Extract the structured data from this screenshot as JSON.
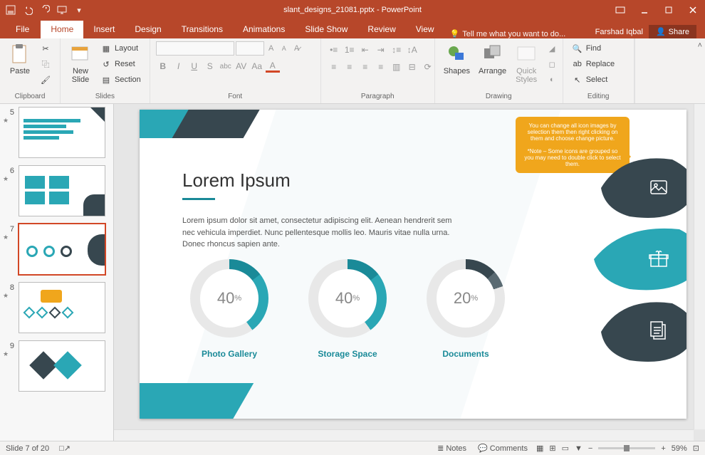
{
  "title": "slant_designs_21081.pptx - PowerPoint",
  "user": "Farshad Iqbal",
  "share": "Share",
  "tellme": "Tell me what you want to do...",
  "tabs": {
    "file": "File",
    "home": "Home",
    "insert": "Insert",
    "design": "Design",
    "transitions": "Transitions",
    "animations": "Animations",
    "slideshow": "Slide Show",
    "review": "Review",
    "view": "View"
  },
  "ribbon": {
    "clipboard": {
      "label": "Clipboard",
      "paste": "Paste"
    },
    "slides": {
      "label": "Slides",
      "new": "New\nSlide",
      "layout": "Layout",
      "reset": "Reset",
      "section": "Section"
    },
    "font": {
      "label": "Font"
    },
    "paragraph": {
      "label": "Paragraph"
    },
    "drawing": {
      "label": "Drawing",
      "shapes": "Shapes",
      "arrange": "Arrange",
      "quick": "Quick\nStyles"
    },
    "editing": {
      "label": "Editing",
      "find": "Find",
      "replace": "Replace",
      "select": "Select"
    }
  },
  "thumbs": [
    {
      "num": "5"
    },
    {
      "num": "6"
    },
    {
      "num": "7",
      "selected": true
    },
    {
      "num": "8"
    },
    {
      "num": "9"
    }
  ],
  "slide": {
    "title": "Lorem Ipsum",
    "body": "Lorem ipsum dolor sit amet, consectetur adipiscing elit. Aenean hendrerit sem nec vehicula imperdiet. Nunc pellentesque mollis leo. Mauris vitae nulla urna. Donec rhoncus sapien ante.",
    "note": "You can change all icon images by selection them then right clicking on them and choose change picture.",
    "note2": "*Note – Some icons are grouped so you may need to double click to select them.",
    "donuts": [
      {
        "value": "40",
        "pct": "%",
        "label": "Photo Gallery",
        "fill": 40
      },
      {
        "value": "40",
        "pct": "%",
        "label": "Storage Space",
        "fill": 40
      },
      {
        "value": "20",
        "pct": "%",
        "label": "Documents",
        "fill": 20
      }
    ]
  },
  "status": {
    "slide": "Slide 7 of 20",
    "notes": "Notes",
    "comments": "Comments",
    "zoom": "59%"
  },
  "chart_data": {
    "type": "pie",
    "series": [
      {
        "name": "Photo Gallery",
        "values": [
          40
        ]
      },
      {
        "name": "Storage Space",
        "values": [
          40
        ]
      },
      {
        "name": "Documents",
        "values": [
          20
        ]
      }
    ],
    "title": "Lorem Ipsum",
    "ylim": [
      0,
      100
    ]
  }
}
